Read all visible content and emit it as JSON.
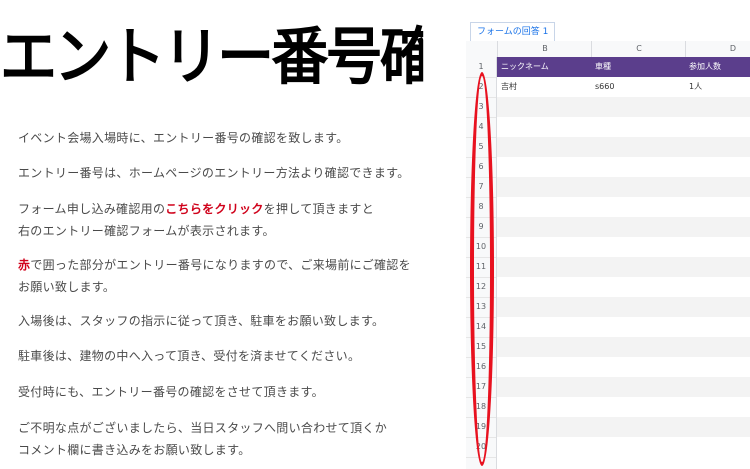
{
  "title": "エントリー番号確認のご案内",
  "body": {
    "p1": "イベント会場入場時に、エントリー番号の確認を致します。",
    "p2": "エントリー番号は、ホームページのエントリー方法より確認できます。",
    "p3_pre": "フォーム申し込み確認用の",
    "p3_link": "こちらをクリック",
    "p3_post": "を押して頂きますと",
    "p3_line2": "右のエントリー確認フォームが表示されます。",
    "p4_accent": "赤",
    "p4_rest": "で囲った部分がエントリー番号になりますので、ご来場前にご確認を",
    "p4_line2": "お願い致します。",
    "p5": "入場後は、スタッフの指示に従って頂き、駐車をお願い致します。",
    "p6": "駐車後は、建物の中へ入って頂き、受付を済ませてください。",
    "p7": "受付時にも、エントリー番号の確認をさせて頂きます。",
    "p8_line1": "ご不明な点がございましたら、当日スタッフへ問い合わせて頂くか",
    "p8_line2": "コメント欄に書き込みをお願い致します。"
  },
  "sheet": {
    "tab_label": "フォームの回答 1",
    "columns": [
      "B",
      "C",
      "D"
    ],
    "header_cells": [
      "ニックネーム",
      "車種",
      "参加人数"
    ],
    "data_row": [
      "吉村",
      "s660",
      "1人"
    ],
    "row_numbers": [
      "1",
      "2",
      "3",
      "4",
      "5",
      "6",
      "7",
      "8",
      "9",
      "10",
      "11",
      "12",
      "13",
      "14",
      "15",
      "16",
      "17",
      "18",
      "19",
      "20"
    ],
    "header_color": "#5b3e8c"
  },
  "colors": {
    "accent_red": "#d0021b",
    "highlight_red": "#e8111f",
    "tab_blue": "#1a73e8"
  }
}
